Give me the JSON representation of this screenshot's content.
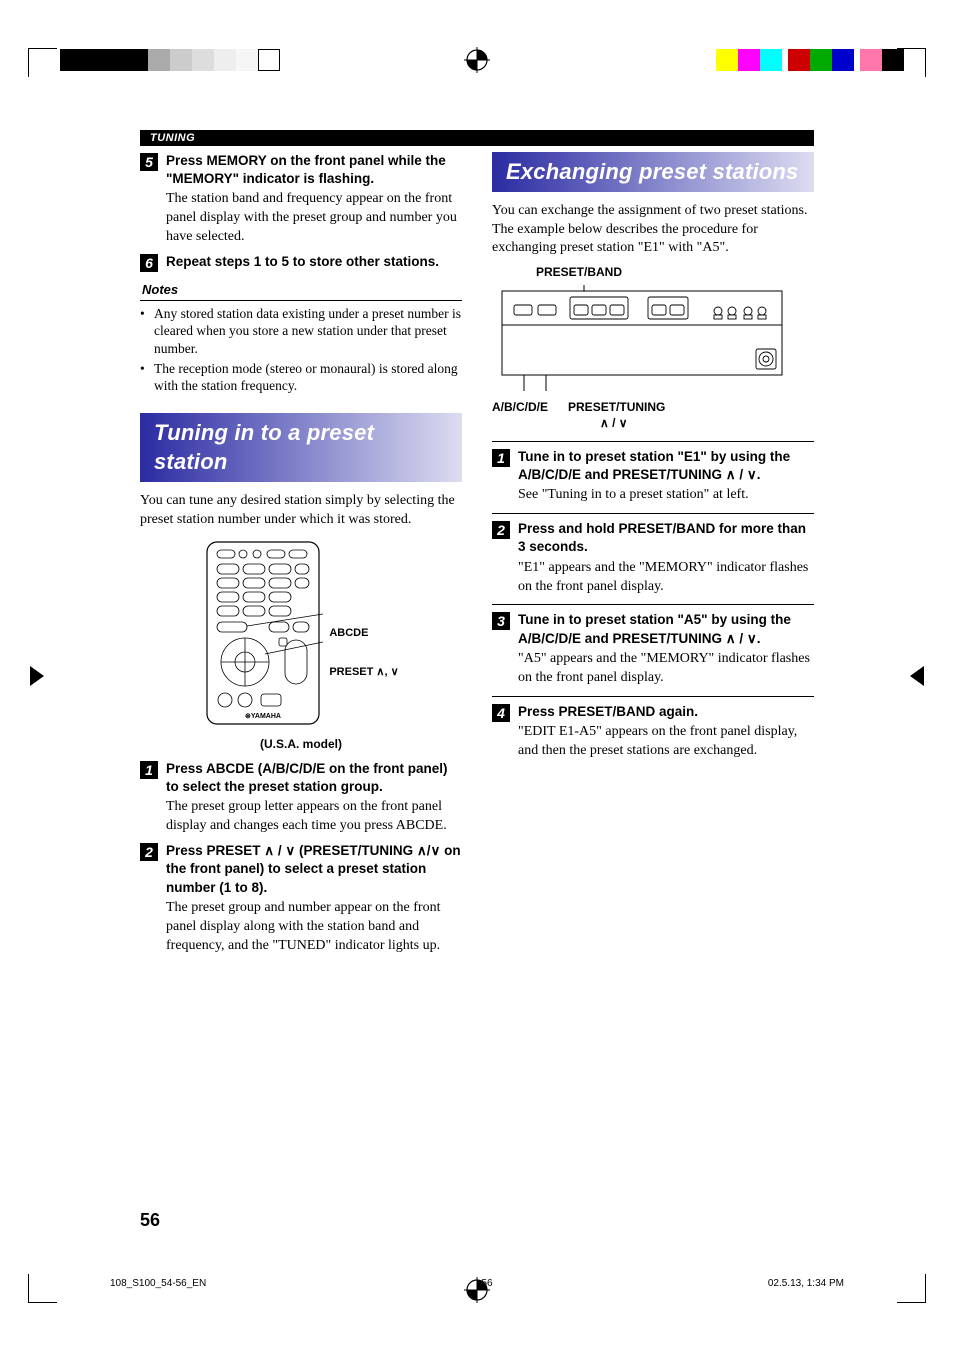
{
  "header_tag": "TUNING",
  "left": {
    "step5": {
      "num": "5",
      "head": "Press MEMORY on the front panel while the \"MEMORY\" indicator is flashing.",
      "body": "The station band and frequency appear on the front panel display with the preset group and number you have selected."
    },
    "step6": {
      "num": "6",
      "head": "Repeat steps 1 to 5 to store other stations."
    },
    "notes_label": "Notes",
    "notes": [
      "Any stored station data existing under a preset number is cleared when you store a new station under that preset number.",
      "The reception mode (stereo or monaural) is stored along with the station frequency."
    ],
    "section_h": "Tuning in to a preset station",
    "intro": "You can tune any desired station simply by selecting the preset station number under which it was stored.",
    "remote_label_abcde": "ABCDE",
    "remote_label_preset": "PRESET ∧, ∨",
    "remote_caption": "(U.S.A. model)",
    "step1": {
      "num": "1",
      "head": "Press ABCDE (A/B/C/D/E on the front panel) to select the preset station group.",
      "body": "The preset group letter appears on the front panel display and changes each time you press ABCDE."
    },
    "step2": {
      "num": "2",
      "head": "Press PRESET ∧ / ∨ (PRESET/TUNING ∧/∨ on the front panel) to select a preset station number (1 to 8).",
      "body": "The preset group and number appear on the front panel display along with the station band and frequency, and the \"TUNED\" indicator lights up."
    }
  },
  "right": {
    "section_h": "Exchanging preset stations",
    "intro": "You can exchange the assignment of two preset stations. The example below describes the procedure for exchanging preset station \"E1\" with \"A5\".",
    "panel_top_caption": "PRESET/BAND",
    "panel_bottom_caption_a": "A/B/C/D/E",
    "panel_bottom_caption_b": "PRESET/TUNING",
    "panel_bottom_caption_c": "∧ / ∨",
    "step1": {
      "num": "1",
      "head": "Tune in to preset station \"E1\" by using the A/B/C/D/E and PRESET/TUNING ∧ / ∨.",
      "body": "See \"Tuning in to a preset station\" at left."
    },
    "step2": {
      "num": "2",
      "head": "Press and hold PRESET/BAND for more than 3 seconds.",
      "body": "\"E1\" appears and the \"MEMORY\" indicator flashes on the front panel display."
    },
    "step3": {
      "num": "3",
      "head": "Tune in to preset station \"A5\" by using the A/B/C/D/E and PRESET/TUNING ∧ / ∨.",
      "body": "\"A5\" appears and the \"MEMORY\" indicator flashes on the front panel display."
    },
    "step4": {
      "num": "4",
      "head": "Press PRESET/BAND again.",
      "body": "\"EDIT E1-A5\" appears on the front panel display, and then the preset stations are exchanged."
    }
  },
  "page_number": "56",
  "footer": {
    "file": "108_S100_54-56_EN",
    "page": "56",
    "date": "02.5.13, 1:34 PM"
  }
}
